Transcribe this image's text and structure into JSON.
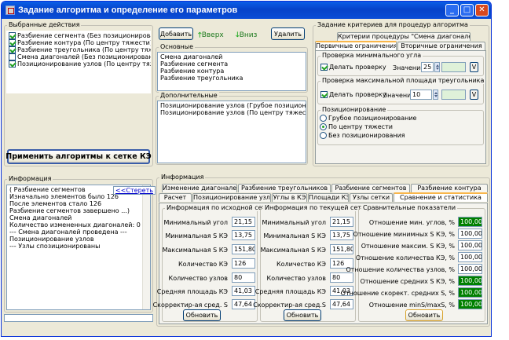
{
  "window": {
    "title": "Задание алгоритма и определение его параметров",
    "controls": [
      "_",
      "□",
      "✕"
    ]
  },
  "actions": {
    "legend": "Выбранные действия",
    "items": [
      {
        "label": "Разбиение сегмента (Без позиционирования)",
        "checked": true
      },
      {
        "label": "Разбиение контура (По центру тяжести)",
        "checked": true
      },
      {
        "label": "Разбиение треугольника (По центру тяжести)",
        "checked": true
      },
      {
        "label": "Смена диагоналей (Без позиционирования)",
        "checked": false
      },
      {
        "label": "Позиционирование узлов (По центру тяжести)",
        "checked": true
      }
    ],
    "apply_label": "Применить алгоритмы к сетке КЭ"
  },
  "toolbar": {
    "add": "Добавить",
    "up": "Вверх",
    "down": "Вниз",
    "delete": "Удалить"
  },
  "main_list": {
    "legend": "Основные",
    "items": [
      "Смена диагоналей",
      "Разбиение сегмента",
      "Разбиение контура",
      "Разбиение треугольника"
    ]
  },
  "extra_list": {
    "legend": "Дополнительные",
    "items": [
      "Позиционирование узлов (Грубое позиционирование)",
      "Позиционирование узлов (По центру тяжести)"
    ]
  },
  "criteria": {
    "legend": "Задание критериев для процедур алгоритма",
    "top_tab": "Критерии процедуры \"Смена диагоналей\"",
    "tabs": [
      "Первичные ограничения",
      "Вторичные ограничения"
    ],
    "min_angle": {
      "legend": "Проверка минимального угла",
      "check_label": "Делать проверку",
      "value_label": "Значение",
      "value": "25",
      "v": "V"
    },
    "max_area": {
      "legend": "Проверка максимальной площади треугольника",
      "check_label": "Делать проверку",
      "value_label": "Значение",
      "value": "10",
      "v": "V"
    },
    "positioning": {
      "legend": "Позиционирование",
      "options": [
        {
          "label": "Грубое позиционирование",
          "selected": false
        },
        {
          "label": "По центру тяжести",
          "selected": true
        },
        {
          "label": "Без позиционирования",
          "selected": false
        }
      ]
    }
  },
  "info": {
    "legend": "Информация",
    "erase": "<<Стереть",
    "lines": [
      "( Разбиение сегментов",
      "Изначально элементов было 126",
      "После элементов стало 126",
      "Разбиение сегментов завершено ...)",
      "Смена диагоналей",
      "Количество измененных диагоналей: 0",
      "--- Смена диагоналей проведена ---",
      "Позиционирование узлов",
      "--- Узлы спозиционированы"
    ]
  },
  "info2": {
    "legend": "Информация",
    "tabs_row1": [
      "Изменение диагоналей",
      "Разбиение треугольников",
      "Разбиение сегментов",
      "Разбиение контура"
    ],
    "tabs_row2": [
      "Расчет",
      "Позиционирование узлов",
      "Углы в КЭ",
      "Площади КЭ",
      "Узлы сетки",
      "Сравнение и статистика"
    ],
    "source": {
      "legend": "Информация по исходной сетке",
      "fields": [
        {
          "label": "Минимальный угол",
          "value": "21,15"
        },
        {
          "label": "Минимальная S КЭ",
          "value": "13,75"
        },
        {
          "label": "Максимальная S КЭ",
          "value": "151,80"
        },
        {
          "label": "Количество КЭ",
          "value": "126"
        },
        {
          "label": "Количество узлов",
          "value": "80"
        },
        {
          "label": "Средняя площадь КЭ",
          "value": "41,03"
        },
        {
          "label": "Скорректир-ая сред. S",
          "value": "47,64"
        }
      ],
      "refresh": "Обновить"
    },
    "current": {
      "legend": "Информация по текущей сетке",
      "fields": [
        {
          "label": "Минимальный угол",
          "value": "21,15"
        },
        {
          "label": "Минимальная S КЭ",
          "value": "13,75"
        },
        {
          "label": "Максимальная S КЭ",
          "value": "151,80"
        },
        {
          "label": "Количество КЭ",
          "value": "126"
        },
        {
          "label": "Количество узлов",
          "value": "80"
        },
        {
          "label": "Средняя площадь КЭ",
          "value": "41,03"
        },
        {
          "label": "Скорректир-ая сред.S",
          "value": "47,64"
        }
      ],
      "refresh": "Обновить"
    },
    "compare": {
      "legend": "Сравнительные показатели",
      "fields": [
        {
          "label": "Отношение мин. углов, %",
          "value": "100,00",
          "green": true
        },
        {
          "label": "Отношение минимных S КЭ, %",
          "value": "100,00",
          "green": false
        },
        {
          "label": "Отношение максим. S КЭ, %",
          "value": "100,00",
          "green": false
        },
        {
          "label": "Отношение количества КЭ, %",
          "value": "100,00",
          "green": false
        },
        {
          "label": "Отношение количества узлов, %",
          "value": "100,00",
          "green": false
        },
        {
          "label": "Отношение средних S КЭ, %",
          "value": "100,00",
          "green": true
        },
        {
          "label": "Отношение скорект. средних S, %",
          "value": "100,00",
          "green": true
        },
        {
          "label": "Отношение minS/maxS, %",
          "value": "100,00",
          "green": true
        }
      ],
      "refresh": "Обновить"
    }
  },
  "colors": {
    "title_bar": "#0a5fe8",
    "face": "#ece9d8",
    "green_value": "#008000",
    "active_tab": "#f9b64a"
  }
}
